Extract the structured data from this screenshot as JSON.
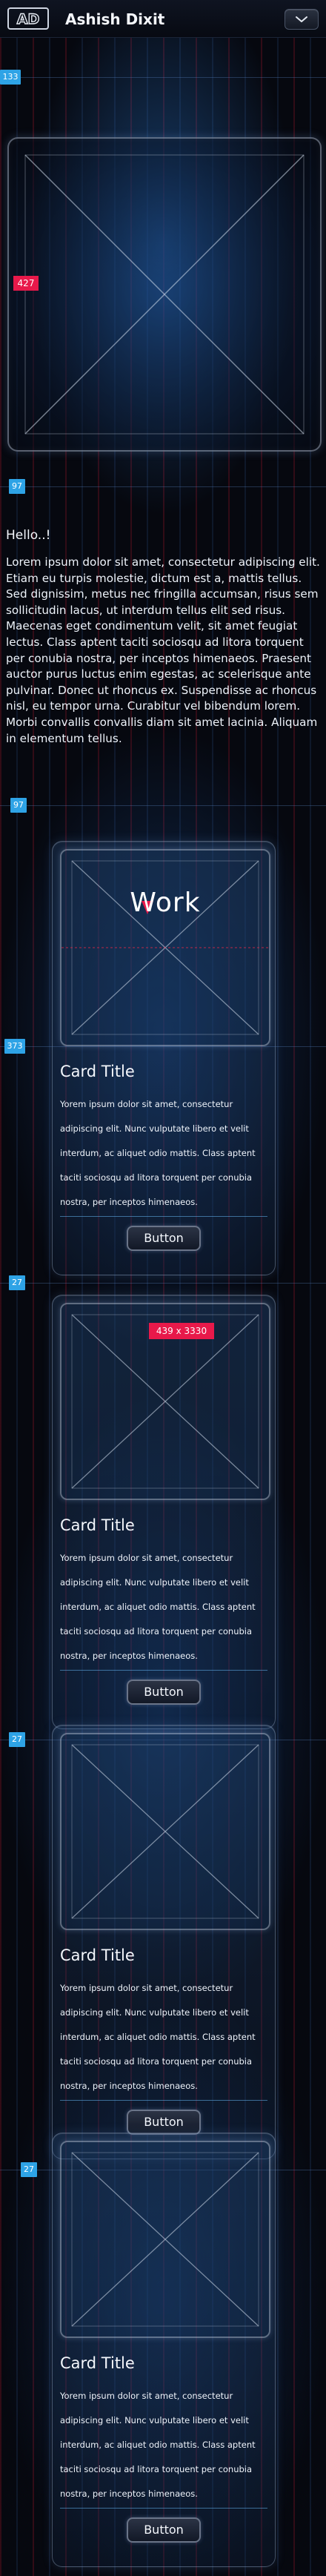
{
  "header": {
    "logo_text": "AD",
    "title": "Ashish Dixit",
    "menu_icon": "chevron-down-icon"
  },
  "markers": {
    "m1": "133",
    "m2": "427",
    "m3": "97",
    "m4": "97",
    "m5": "373",
    "m6": "27",
    "m7": "27",
    "m8": "27"
  },
  "intro": {
    "greeting": "Hello..!",
    "body": "Lorem ipsum dolor sit amet, consectetur adipiscing elit. Etiam eu turpis molestie, dictum est a, mattis tellus. Sed dignissim, metus nec fringilla accumsan, risus sem sollicitudin lacus, ut interdum tellus elit sed risus. Maecenas eget condimentum velit, sit amet feugiat lectus. Class aptent taciti sociosqu ad litora torquent per conubia nostra, per inceptos himenaeos. Praesent auctor purus luctus enim egestas, ac scelerisque ante pulvinar. Donec ut rhoncus ex. Suspendisse ac rhoncus nisl, eu tempor urna. Curabitur vel bibendum lorem. Morbi convallis convallis diam sit amet lacinia. Aliquam in elementum tellus."
  },
  "cards": [
    {
      "overlay_title": "Work",
      "title": "Card Title",
      "body": "Yorem ipsum dolor sit amet, consectetur adipiscing elit. Nunc vulputate libero et velit interdum, ac aliquet odio mattis. Class aptent taciti sociosqu ad litora torquent per conubia nostra, per inceptos himenaeos.",
      "button": "Button"
    },
    {
      "dimension_badge": "439 x 3330",
      "title": "Card Title",
      "body": "Yorem ipsum dolor sit amet, consectetur adipiscing elit. Nunc vulputate libero et velit interdum, ac aliquet odio mattis. Class aptent taciti sociosqu ad litora torquent per conubia nostra, per inceptos himenaeos.",
      "button": "Button"
    },
    {
      "title": "Card Title",
      "body": "Yorem ipsum dolor sit amet, consectetur adipiscing elit. Nunc vulputate libero et velit interdum, ac aliquet odio mattis. Class aptent taciti sociosqu ad litora torquent per conubia nostra, per inceptos himenaeos.",
      "button": "Button"
    },
    {
      "title": "Card Title",
      "body": "Yorem ipsum dolor sit amet, consectetur adipiscing elit. Nunc vulputate libero et velit interdum, ac aliquet odio mattis. Class aptent taciti sociosqu ad litora torquent per conubia nostra, per inceptos himenaeos.",
      "button": "Button"
    }
  ],
  "colors": {
    "marker_blue": "#2ea3e6",
    "badge_red": "#e8194a",
    "background": "#06080f"
  }
}
